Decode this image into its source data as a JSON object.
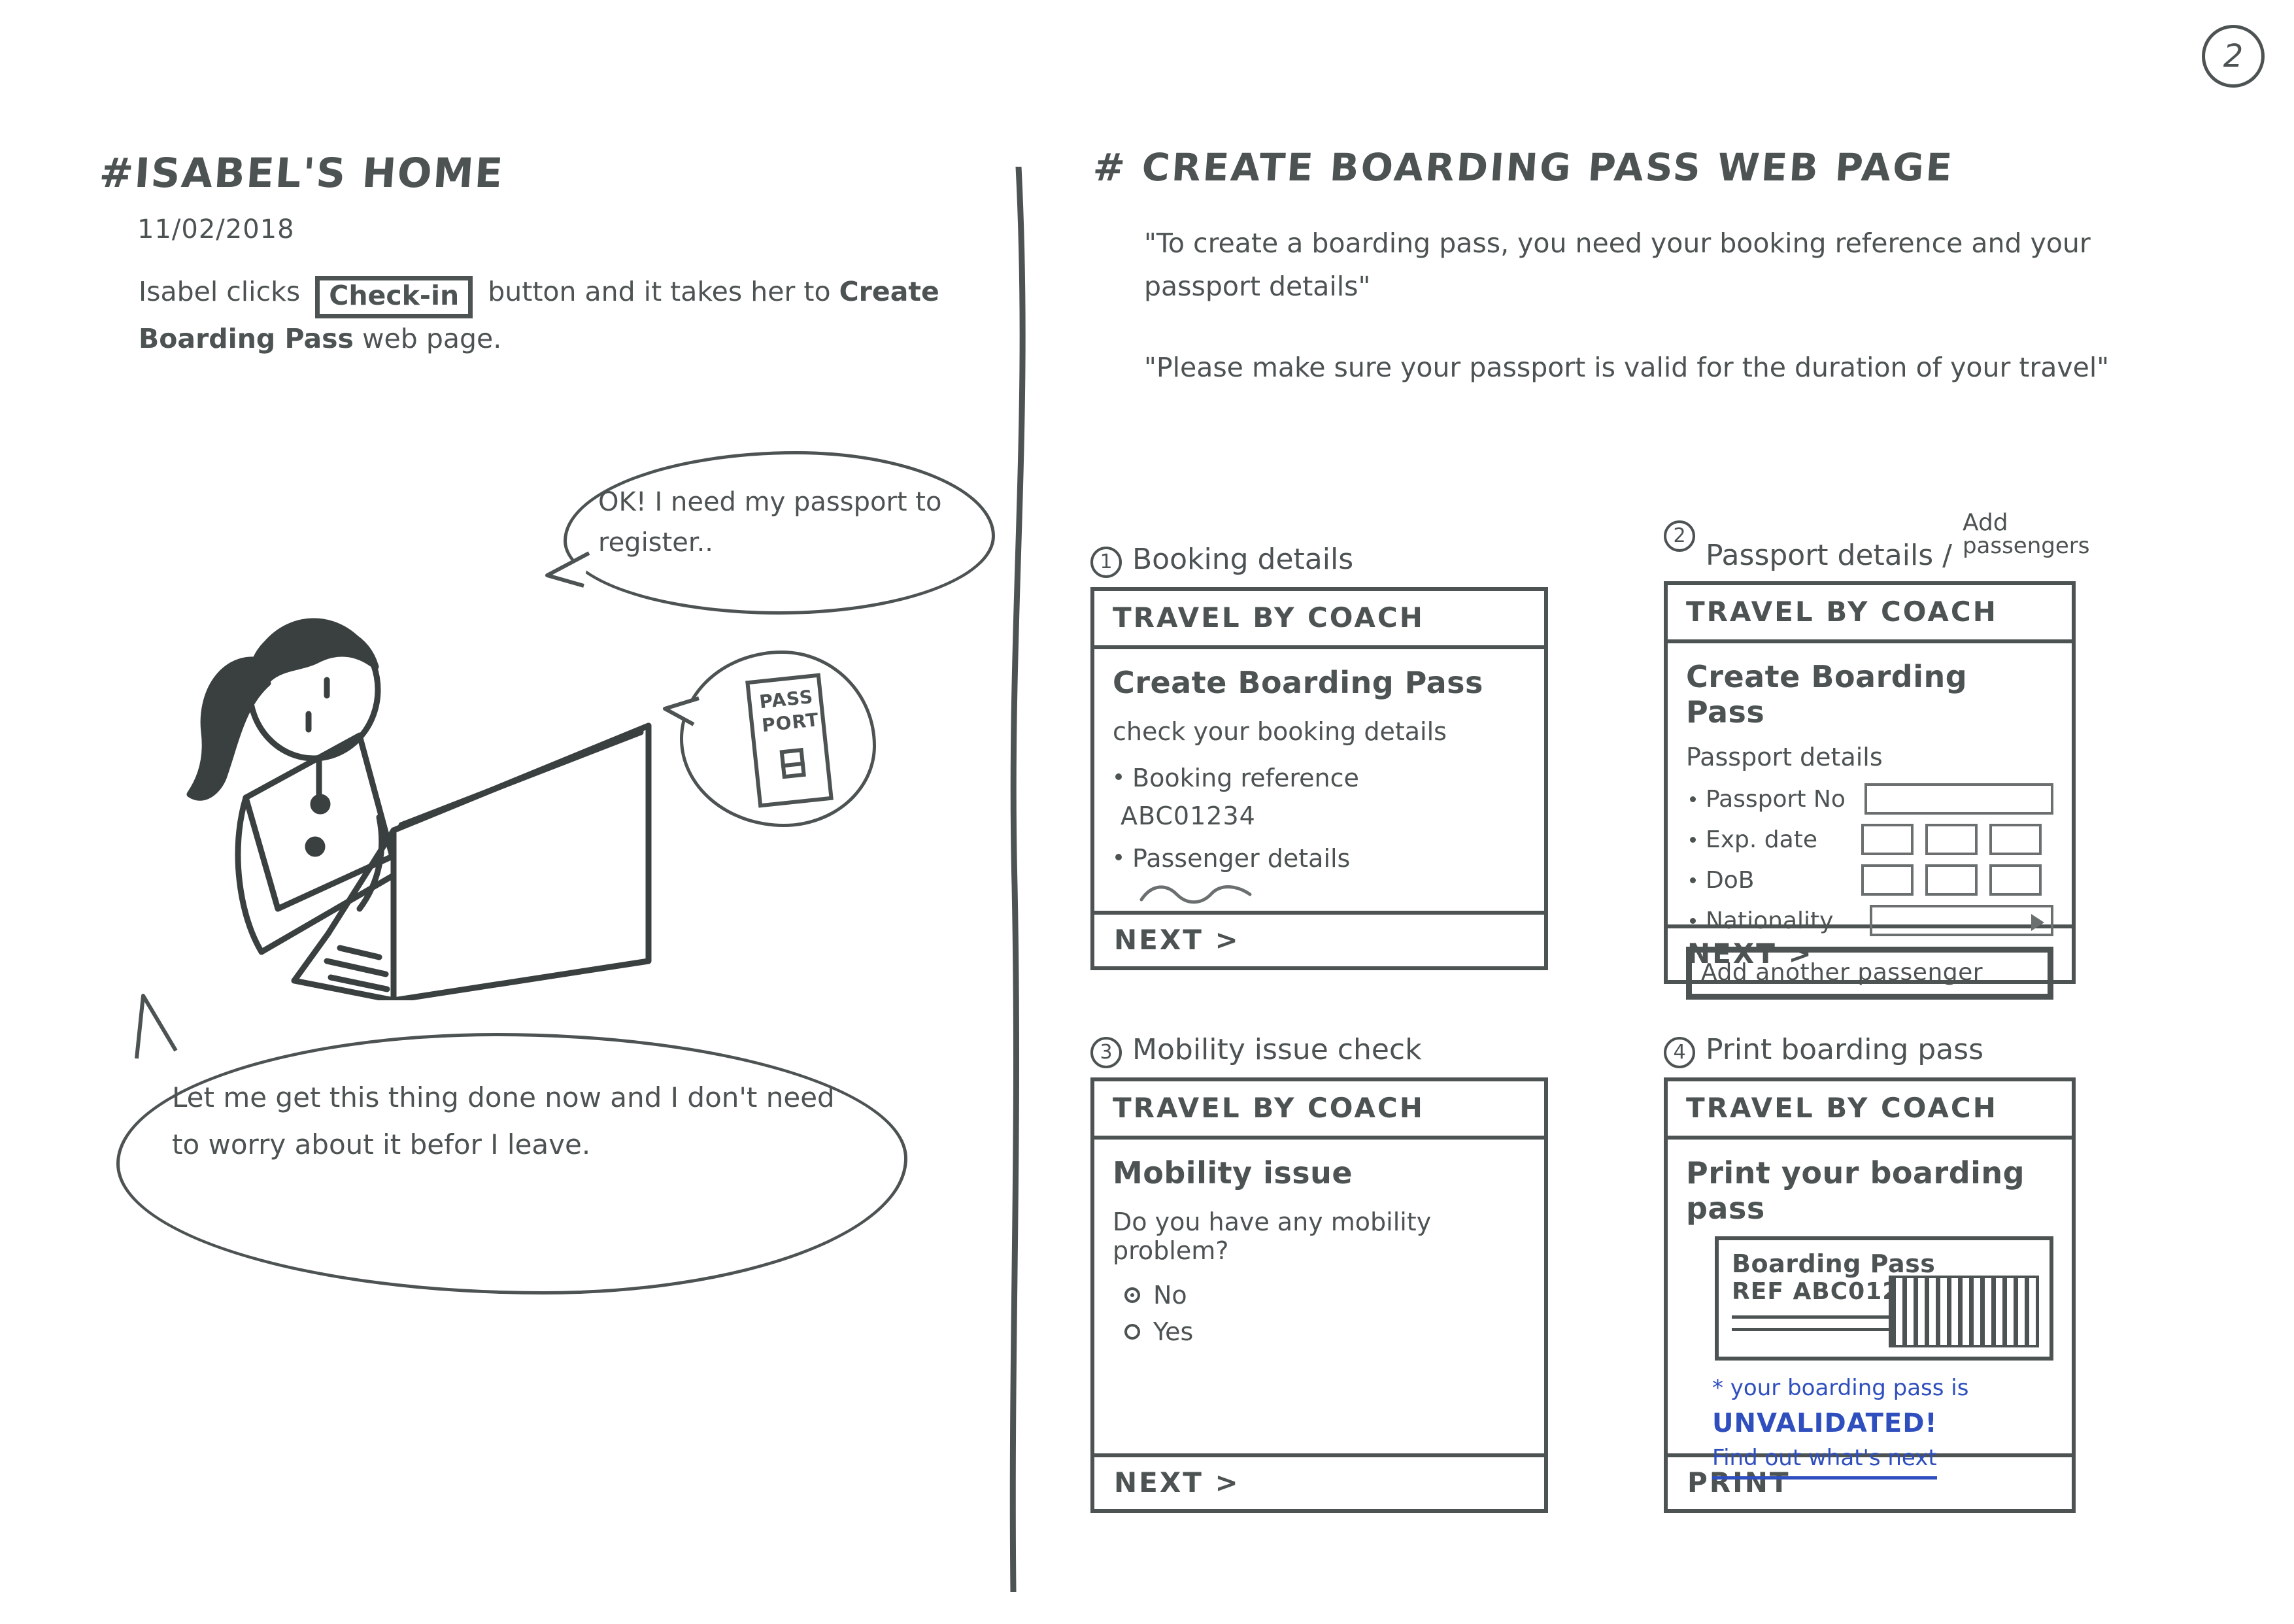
{
  "page": {
    "number": "2"
  },
  "left": {
    "title": "#ISABEL'S HOME",
    "date": "11/02/2018",
    "body_pre": "Isabel clicks",
    "body_chip": "Check-in",
    "body_mid": "button and it takes her to",
    "body_bold": "Create Boarding Pass",
    "body_post": "web page.",
    "bubble_ok": "OK! I need my passport to register..",
    "passport_line1": "PASS",
    "passport_line2": "PORT",
    "bubble_big": "Let me get this thing done now and I don't need to worry about it befor I leave."
  },
  "right": {
    "title": "# CREATE BOARDING PASS WEB PAGE",
    "quote1": "\"To create a boarding pass, you need your booking reference and your passport details\"",
    "quote2": "\"Please make sure your passport is valid for the duration of your travel\"",
    "brand": "TRAVEL BY COACH",
    "wireframes": [
      {
        "num": "1",
        "caption": "Booking details",
        "caption_sup_top": "",
        "caption_sup_bottom": "",
        "heading": "Create Boarding Pass",
        "sub": "check your booking details",
        "bullet1": "Booking reference",
        "ref": "ABC01234",
        "bullet2": "Passenger details",
        "footer": "NEXT >"
      },
      {
        "num": "2",
        "caption": "Passport details /",
        "caption_sup_top": "Add",
        "caption_sup_bottom": "passengers",
        "heading": "Create Boarding Pass",
        "sub": "Passport details",
        "field1": "Passport No",
        "field2": "Exp. date",
        "field3": "DoB",
        "field4": "Nationality",
        "add_passenger": "Add another passenger",
        "footer": "NEXT >"
      },
      {
        "num": "3",
        "caption": "Mobility issue check",
        "caption_sup_top": "",
        "caption_sup_bottom": "",
        "heading": "Mobility issue",
        "question": "Do you have any mobility problem?",
        "option_no": "No",
        "option_yes": "Yes",
        "footer": "NEXT >"
      },
      {
        "num": "4",
        "caption": "Print boarding pass",
        "caption_sup_top": "",
        "caption_sup_bottom": "",
        "heading": "Print your boarding pass",
        "ticket_title": "Boarding Pass",
        "ticket_ref": "REF ABC01234",
        "note_line1": "* your boarding pass is",
        "note_line2": "UNVALIDATED!",
        "note_link": "Find out what's next",
        "footer": "PRINT"
      }
    ]
  },
  "colors": {
    "ink": "#4d5252",
    "blue": "#2f4fbe"
  }
}
